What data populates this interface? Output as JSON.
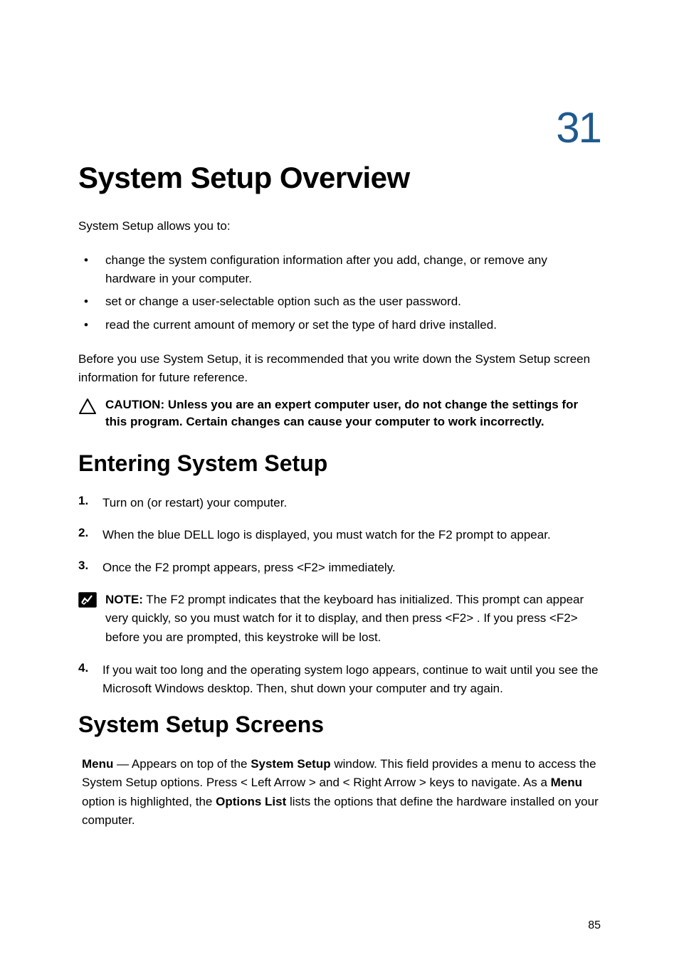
{
  "chapter": {
    "number": "31",
    "title": "System Setup Overview"
  },
  "intro": "System Setup allows you to:",
  "bullets": [
    "change the system configuration information after you add, change, or remove any hardware in your computer.",
    "set or change a user-selectable option such as the user password.",
    "read the current amount of memory or set the type of hard drive installed."
  ],
  "before_text": "Before you use System Setup, it is recommended that you write down the System Setup screen information for future reference.",
  "caution": {
    "label": "CAUTION:",
    "text": " Unless you are an expert computer user, do not change the settings for this program. Certain changes can cause your computer to work incorrectly."
  },
  "section1": {
    "heading": "Entering System Setup",
    "steps": [
      {
        "num": "1.",
        "text": "Turn on (or restart) your computer."
      },
      {
        "num": "2.",
        "text": "When the blue DELL logo is displayed, you must watch for the F2 prompt to appear."
      },
      {
        "num": "3.",
        "text": "Once the F2 prompt appears, press <F2> immediately."
      }
    ],
    "note": {
      "label": "NOTE:",
      "text": " The F2 prompt indicates that the keyboard has initialized. This prompt can appear very quickly, so you must watch for it to display, and then press <F2> . If you press <F2> before you are prompted, this keystroke will be lost."
    },
    "step4": {
      "num": "4.",
      "text": "If you wait too long and the operating system logo appears, continue to wait until you see the Microsoft Windows desktop. Then, shut down your computer and try again."
    }
  },
  "section2": {
    "heading": "System Setup Screens",
    "menu_label": "Menu",
    "menu_text1": " — Appears on top of the ",
    "system_setup_label": "System Setup",
    "menu_text2": " window. This field provides a menu to access the System Setup options. Press < Left Arrow > and < Right Arrow > keys to navigate. As a ",
    "menu_label2": "Menu",
    "menu_text3": " option is highlighted, the ",
    "options_list_label": "Options List",
    "menu_text4": " lists the options that define the hardware installed on your computer."
  },
  "page_number": "85"
}
